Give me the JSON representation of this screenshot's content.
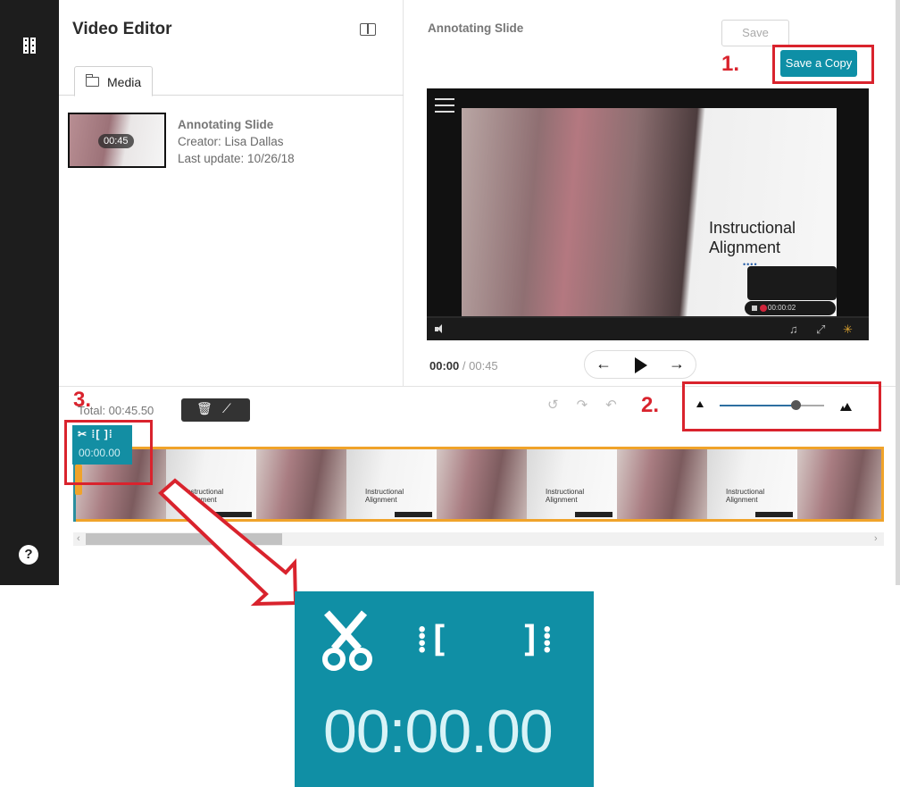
{
  "sidebar": {
    "icons": [
      "film-icon",
      "help-icon"
    ],
    "help_glyph": "?"
  },
  "editor": {
    "title": "Video Editor",
    "tabs": [
      {
        "label": "Media",
        "icon": "folder-icon"
      }
    ],
    "media_item": {
      "duration": "00:45",
      "title": "Annotating Slide",
      "creator": "Creator: Lisa Dallas",
      "updated": "Last update: 10/26/18"
    }
  },
  "preview": {
    "title": "Annotating Slide",
    "save_label": "Save",
    "save_copy_label": "Save a Copy",
    "slide_title_line1": "Instructional",
    "slide_title_line2": "Alignment",
    "slide_dots": "••••",
    "recording_time": "00:00:02",
    "current_time": "00:00",
    "separator": "/",
    "total_time": "00:45",
    "nav": {
      "back": "←",
      "forward": "→"
    }
  },
  "timeline": {
    "total_label": "Total: 00:45.50",
    "tool_icons": [
      "trash-icon",
      "magic-wand-icon"
    ],
    "undo_icons": [
      "restore-icon",
      "redo-icon",
      "undo-icon"
    ],
    "zoom_level": 0.73,
    "playhead_time": "00:00.00",
    "playhead_icons": "✂ ⁞[ ]⁞",
    "thumbnail_caption_line1": "Instructional",
    "thumbnail_caption_line2": "Alignment",
    "frames": [
      "photo",
      "text",
      "photo",
      "text",
      "photo",
      "text",
      "photo",
      "text",
      "photo"
    ]
  },
  "annotations": {
    "step1": "1.",
    "step2": "2.",
    "step3": "3."
  },
  "callout": {
    "timecode": "00:00.00",
    "icons": [
      "scissors-icon",
      "trim-start-icon",
      "trim-end-icon"
    ],
    "trim_start_glyph": "⁞[",
    "trim_end_glyph": "]⁞"
  },
  "colors": {
    "accent_teal": "#0e8fa6",
    "annotation_red": "#d9232d",
    "timeline_orange": "#f0a32a"
  }
}
